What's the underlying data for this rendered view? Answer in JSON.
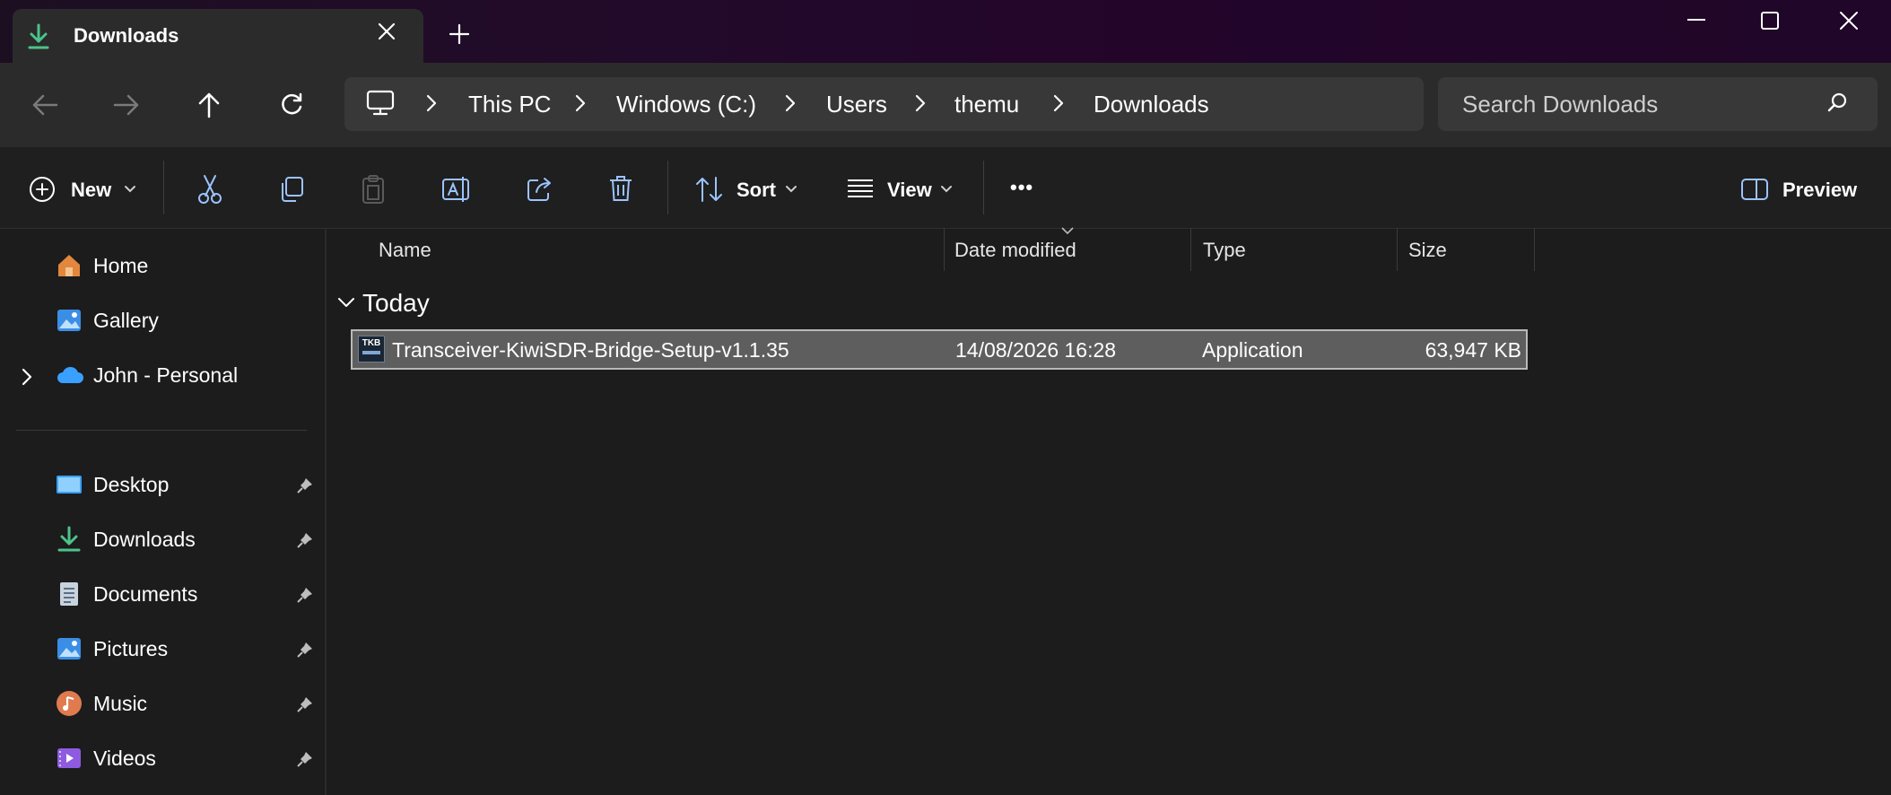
{
  "titlebar": {
    "tab_title": "Downloads",
    "new_tab_symbol": "+"
  },
  "nav": {
    "breadcrumb": [
      "This PC",
      "Windows (C:)",
      "Users",
      "themu",
      "Downloads"
    ],
    "search_placeholder": "Search Downloads"
  },
  "toolbar": {
    "new_label": "New",
    "sort_label": "Sort",
    "view_label": "View",
    "more_label": "•••",
    "preview_label": "Preview"
  },
  "sidebar": {
    "top_items": [
      {
        "label": "Home",
        "icon": "home-icon"
      },
      {
        "label": "Gallery",
        "icon": "gallery-icon"
      },
      {
        "label": "John - Personal",
        "icon": "cloud-icon"
      }
    ],
    "pinned_items": [
      {
        "label": "Desktop",
        "icon": "desktop-icon"
      },
      {
        "label": "Downloads",
        "icon": "downloads-icon"
      },
      {
        "label": "Documents",
        "icon": "documents-icon"
      },
      {
        "label": "Pictures",
        "icon": "pictures-icon"
      },
      {
        "label": "Music",
        "icon": "music-icon"
      },
      {
        "label": "Videos",
        "icon": "videos-icon"
      }
    ]
  },
  "content": {
    "columns": [
      "Name",
      "Date modified",
      "Type",
      "Size"
    ],
    "group": "Today",
    "files": [
      {
        "name": "Transceiver-KiwiSDR-Bridge-Setup-v1.1.35",
        "date_modified": "14/08/2026 16:28",
        "type": "Application",
        "size": "63,947 KB",
        "icon_text": "TKB"
      }
    ]
  },
  "colors": {
    "accent_green": "#4cc38a",
    "folder_blue": "#3aa0ff",
    "selection": "#5e5e5e"
  }
}
